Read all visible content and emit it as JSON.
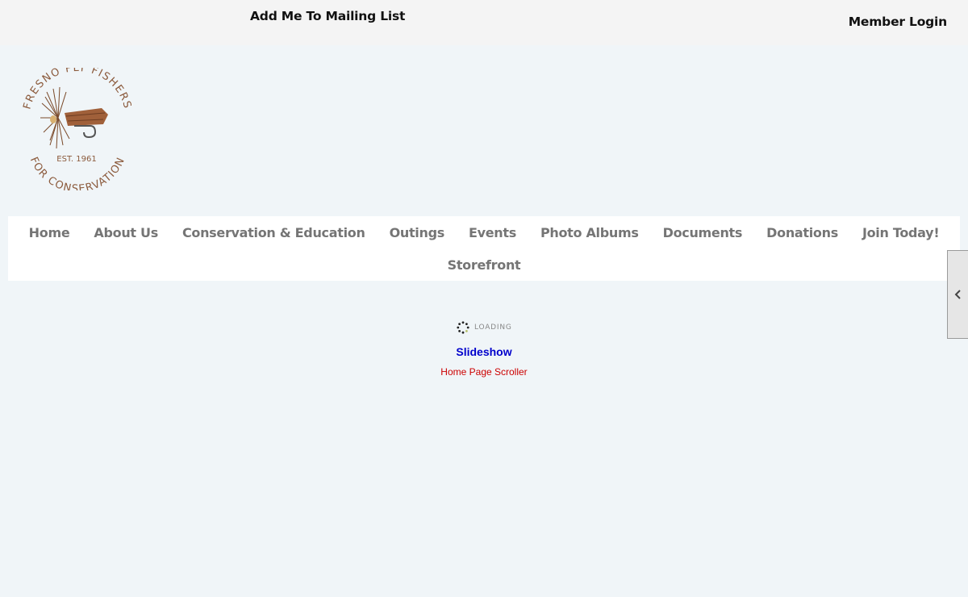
{
  "header": {
    "mailing_list": "Add Me To Mailing List",
    "member_login": "Member Login"
  },
  "logo": {
    "top_text": "FRESNO FLY FISHERS",
    "bottom_text": "FOR CONSERVATION",
    "established": "EST. 1961",
    "color": "#8b5a3c"
  },
  "nav": {
    "items": [
      {
        "label": "Home"
      },
      {
        "label": "About Us"
      },
      {
        "label": "Conservation & Education"
      },
      {
        "label": "Outings"
      },
      {
        "label": "Events"
      },
      {
        "label": "Photo Albums"
      },
      {
        "label": "Documents"
      },
      {
        "label": "Donations"
      },
      {
        "label": "Join Today!"
      },
      {
        "label": "Storefront"
      }
    ],
    "color": "#757575"
  },
  "side_tab": {
    "icon": "chevron-left-icon"
  },
  "main": {
    "loading_text": "LOADING",
    "slideshow_label": "Slideshow",
    "scroller_label": "Home Page Scroller"
  }
}
